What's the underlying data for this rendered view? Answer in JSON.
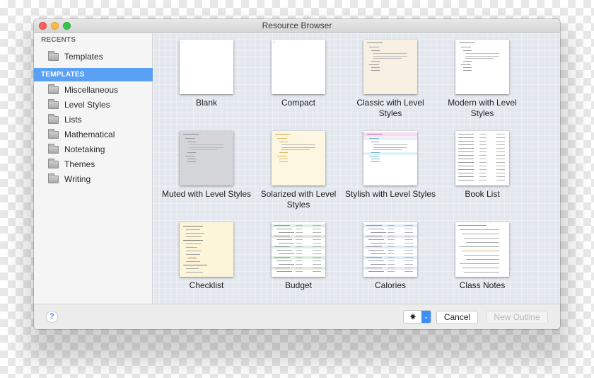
{
  "window": {
    "title": "Resource Browser"
  },
  "sidebar": {
    "recents_header": "RECENTS",
    "recents": [
      {
        "label": "Templates",
        "icon": "folder-icon"
      }
    ],
    "templates_header": "TEMPLATES",
    "templates_header_selected": true,
    "templates": [
      {
        "label": "Miscellaneous",
        "icon": "folder-icon"
      },
      {
        "label": "Level Styles",
        "icon": "folder-icon"
      },
      {
        "label": "Lists",
        "icon": "folder-icon"
      },
      {
        "label": "Mathematical",
        "icon": "folder-icon"
      },
      {
        "label": "Notetaking",
        "icon": "folder-icon"
      },
      {
        "label": "Themes",
        "icon": "folder-icon"
      },
      {
        "label": "Writing",
        "icon": "folder-icon"
      }
    ]
  },
  "grid": {
    "items": [
      {
        "label": "Blank",
        "thumb_bg": "#ffffff",
        "style": "blank"
      },
      {
        "label": "Compact",
        "thumb_bg": "#ffffff",
        "style": "blank"
      },
      {
        "label": "Classic with Level Styles",
        "thumb_bg": "#f7f0e3",
        "style": "outline"
      },
      {
        "label": "Modern with Level Styles",
        "thumb_bg": "#ffffff",
        "style": "outline"
      },
      {
        "label": "Muted with Level Styles",
        "thumb_bg": "#d3d5d8",
        "style": "outline"
      },
      {
        "label": "Solarized with Level Styles",
        "thumb_bg": "#fdf6e0",
        "style": "outline-gold"
      },
      {
        "label": "Stylish with Level Styles",
        "thumb_bg": "#ffffff",
        "style": "outline-pink"
      },
      {
        "label": "Book List",
        "thumb_bg": "#ffffff",
        "style": "table"
      },
      {
        "label": "Checklist",
        "thumb_bg": "#fcf5d9",
        "style": "checklist"
      },
      {
        "label": "Budget",
        "thumb_bg": "#ffffff",
        "style": "table-green"
      },
      {
        "label": "Calories",
        "thumb_bg": "#ffffff",
        "style": "table-blue"
      },
      {
        "label": "Class Notes",
        "thumb_bg": "#ffffff",
        "style": "notes"
      }
    ]
  },
  "footer": {
    "help_label": "?",
    "gear_icon": "gear-icon",
    "gear_glyph": "✷",
    "gear_arrow_glyph": "⌄",
    "cancel_label": "Cancel",
    "new_outline_label": "New Outline",
    "new_outline_enabled": false
  },
  "colors": {
    "selection": "#5aa0f5",
    "accent": "#3d8ef5"
  }
}
